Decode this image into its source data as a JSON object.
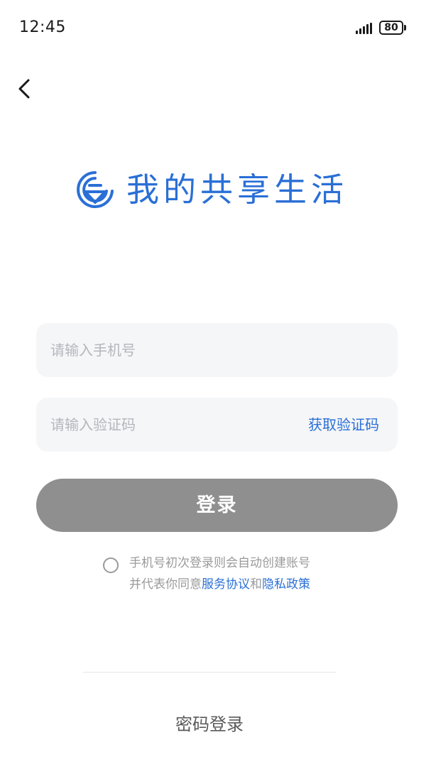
{
  "status_bar": {
    "time": "12:45",
    "battery_level": "80",
    "icons": [
      "signal-icon",
      "battery-icon"
    ]
  },
  "nav": {
    "back_icon": "chevron-left-icon"
  },
  "brand": {
    "logo_icon": "brand-logo-icon",
    "name": "我的共享生活",
    "color": "#2a6fd6"
  },
  "form": {
    "phone": {
      "value": "",
      "placeholder": "请输入手机号"
    },
    "code": {
      "value": "",
      "placeholder": "请输入验证码"
    },
    "get_code_label": "获取验证码",
    "login_label": "登录",
    "login_button_color": "#8f8f8f"
  },
  "agreement": {
    "checked": false,
    "line1": "手机号初次登录则会自动创建账号",
    "line2_prefix": "并代表你同意",
    "terms_link": "服务协议",
    "conjunction": "和",
    "privacy_link": "隐私政策",
    "link_color": "#2a6fd6"
  },
  "footer": {
    "password_login_label": "密码登录"
  }
}
